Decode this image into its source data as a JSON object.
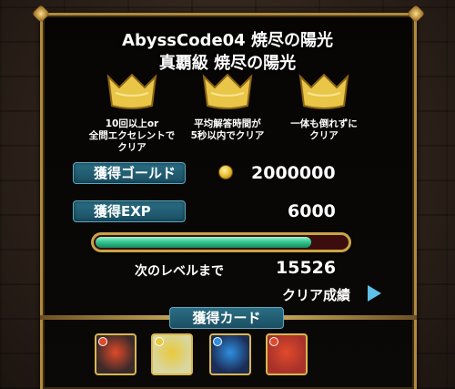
{
  "header": {
    "title": "AbyssCode04 焼尽の陽光",
    "subtitle": "真覇級 焼尽の陽光"
  },
  "crowns": [
    {
      "icon": "gold-crown-icon",
      "label_lines": [
        "10回以上or",
        "全問エクセレントで",
        "クリア"
      ]
    },
    {
      "icon": "gold-crown-icon",
      "label_lines": [
        "平均解答時間が",
        "5秒以内でクリア"
      ]
    },
    {
      "icon": "gold-crown-icon",
      "label_lines": [
        "一体も倒れずに",
        "クリア"
      ]
    }
  ],
  "gold": {
    "label": "獲得ゴールド",
    "value": "2000000",
    "icon": "coin-icon"
  },
  "exp": {
    "label": "獲得EXP",
    "value": "6000"
  },
  "level": {
    "progress": 0.86,
    "next_label": "次のレベルまで",
    "next_value": "15526"
  },
  "clear_record": {
    "label": "クリア成績",
    "icon": "play-arrow-icon"
  },
  "cards": {
    "label": "獲得カード",
    "items": [
      {
        "name": "card-dark-armor",
        "attr_color": "#e04a2a",
        "bg": "#3a2a2a"
      },
      {
        "name": "card-light-mage",
        "attr_color": "#e8c93a",
        "bg": "#d9d6a0"
      },
      {
        "name": "card-water-dragon",
        "attr_color": "#2f8fe0",
        "bg": "#1b2c55"
      },
      {
        "name": "card-fire-maiden",
        "attr_color": "#e04a2a",
        "bg": "#a8322a"
      }
    ]
  },
  "colors": {
    "accent_gold": "#c9a447",
    "label_teal": "#1b4f63",
    "exp_green": "#35c792"
  }
}
